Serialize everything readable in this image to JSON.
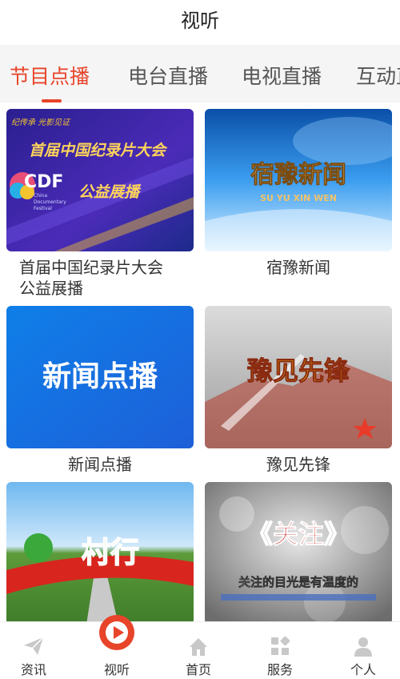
{
  "header": {
    "title": "视听"
  },
  "tabs": [
    {
      "label": "节目点播",
      "active": true
    },
    {
      "label": "电台直播",
      "active": false
    },
    {
      "label": "电视直播",
      "active": false
    },
    {
      "label": "互动直",
      "active": false
    }
  ],
  "programs": [
    {
      "caption": "首届中国纪录片大会公益展播",
      "thumb_text": {
        "slogan": "纪传承  光影见证",
        "headline": "首届中国纪录片大会",
        "sub": "公益展播",
        "logo": "CDF",
        "logo_sub1": "China",
        "logo_sub2": "Documentary",
        "logo_sub3": "Festival"
      }
    },
    {
      "caption": "宿豫新闻",
      "thumb_text": {
        "headline": "宿豫新闻",
        "sub": "SU YU XIN WEN"
      }
    },
    {
      "caption": "新闻点播",
      "thumb_text": {
        "headline": "新闻点播"
      }
    },
    {
      "caption": "豫见先锋",
      "thumb_text": {
        "headline": "豫见先锋"
      }
    },
    {
      "caption": "",
      "thumb_text": {
        "headline": "村行"
      }
    },
    {
      "caption": "",
      "thumb_text": {
        "headline": "《关注》",
        "sub": "关注的目光是有温度的"
      }
    }
  ],
  "bottom_nav": [
    {
      "label": "资讯",
      "icon": "paper-plane-icon",
      "active": false
    },
    {
      "label": "视听",
      "icon": "play-circle-icon",
      "active": true
    },
    {
      "label": "首页",
      "icon": "home-icon",
      "active": false
    },
    {
      "label": "服务",
      "icon": "grid-icon",
      "active": false
    },
    {
      "label": "个人",
      "icon": "person-icon",
      "active": false
    }
  ],
  "colors": {
    "accent": "#e8442a",
    "tab_bar_bg": "#f5f5f5",
    "inactive_icon": "#c8c8c8"
  }
}
